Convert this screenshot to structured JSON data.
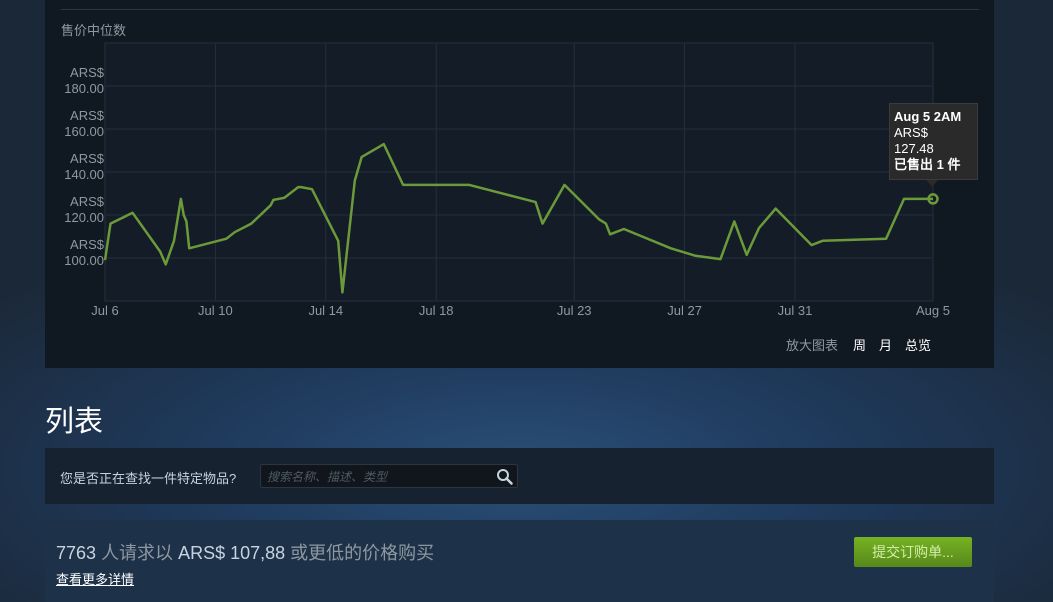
{
  "chart": {
    "title": "售价中位数",
    "zoom_label": "放大图表",
    "zoom_options": [
      "周",
      "月",
      "总览"
    ]
  },
  "tooltip": {
    "date": "Aug 5 2AM",
    "currency": "ARS$",
    "price": "127.48",
    "sold": "已售出 1 件"
  },
  "listings": {
    "heading": "列表",
    "search_label": "您是否正在查找一件特定物品?",
    "search_placeholder": "搜索名称、描述、类型"
  },
  "buy_order": {
    "count": "7763",
    "text_before": "人请求以",
    "price": "ARS$ 107,88",
    "text_after": "或更低的价格购买",
    "details_link": "查看更多详情",
    "button_label": "提交订购单..."
  },
  "colors": {
    "line": "#6c9a3a",
    "accent_green": "#75b022"
  },
  "chart_data": {
    "type": "line",
    "x_unit": "days since Jul 6",
    "x_tick_labels": [
      "Jul 6",
      "Jul 10",
      "Jul 14",
      "Jul 18",
      "Jul 23",
      "Jul 27",
      "Jul 31",
      "Aug 5"
    ],
    "x_tick_values": [
      0,
      4,
      8,
      12,
      17,
      21,
      25,
      30
    ],
    "y_tick_labels": [
      {
        "currency": "ARS$",
        "value": "100.00"
      },
      {
        "currency": "ARS$",
        "value": "120.00"
      },
      {
        "currency": "ARS$",
        "value": "140.00"
      },
      {
        "currency": "ARS$",
        "value": "160.00"
      },
      {
        "currency": "ARS$",
        "value": "180.00"
      }
    ],
    "y_tick_values": [
      100,
      120,
      140,
      160,
      180
    ],
    "xlim": [
      0,
      30
    ],
    "ylim": [
      80,
      200
    ],
    "grid": true,
    "x": [
      0,
      0.2,
      1,
      2,
      2.2,
      2.5,
      2.75,
      2.85,
      2.95,
      3.05,
      4.4,
      4.7,
      5.3,
      6.0,
      6.1,
      6.5,
      7.0,
      7.1,
      7.5,
      8.45,
      8.6,
      9.05,
      9.3,
      10.1,
      10.8,
      12.0,
      13.2,
      15.6,
      15.85,
      16.65,
      17.9,
      18.15,
      18.3,
      18.8,
      20.5,
      21.4,
      22.3,
      22.8,
      23.25,
      23.7,
      24.3,
      25.6,
      26.0,
      28.3,
      28.95,
      30.0
    ],
    "y": [
      99,
      116,
      121,
      103,
      97,
      108,
      127.5,
      120,
      117,
      104.5,
      109,
      112,
      116,
      124.5,
      127,
      128,
      133,
      133,
      132,
      108,
      84,
      136,
      147,
      153,
      134,
      134,
      134,
      126,
      116,
      134,
      118,
      116,
      111,
      113.5,
      104.5,
      101,
      99.5,
      117,
      101.5,
      114,
      123,
      106,
      108,
      109,
      127.48,
      127.48
    ]
  }
}
